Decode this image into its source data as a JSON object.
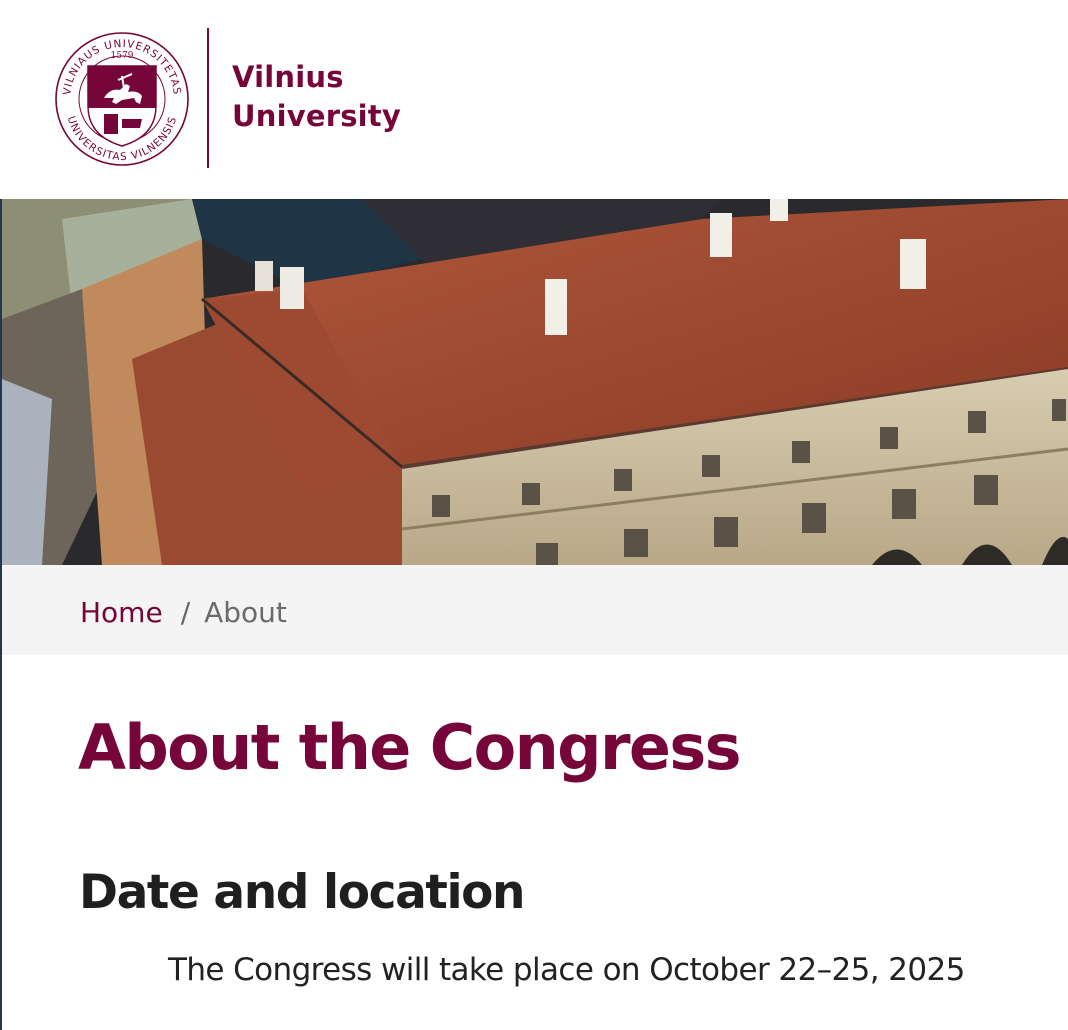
{
  "header": {
    "logo": {
      "seal_text_top": "VILNIAUS UNIVERSITETAS",
      "seal_text_bottom": "UNIVERSITAS VILNENSIS",
      "seal_year": "1579",
      "name_line1": "Vilnius",
      "name_line2": "University"
    }
  },
  "hero": {
    "image": "aerial-university-building"
  },
  "breadcrumb": {
    "home": "Home",
    "separator": "/",
    "current": "About"
  },
  "content": {
    "title": "About the Congress",
    "section_heading": "Date and location",
    "paragraph": "The Congress will take place on October 22–25, 2025"
  },
  "colors": {
    "brand": "#76063a",
    "breadcrumb_bg": "#f4f4f4",
    "text": "#222222"
  }
}
